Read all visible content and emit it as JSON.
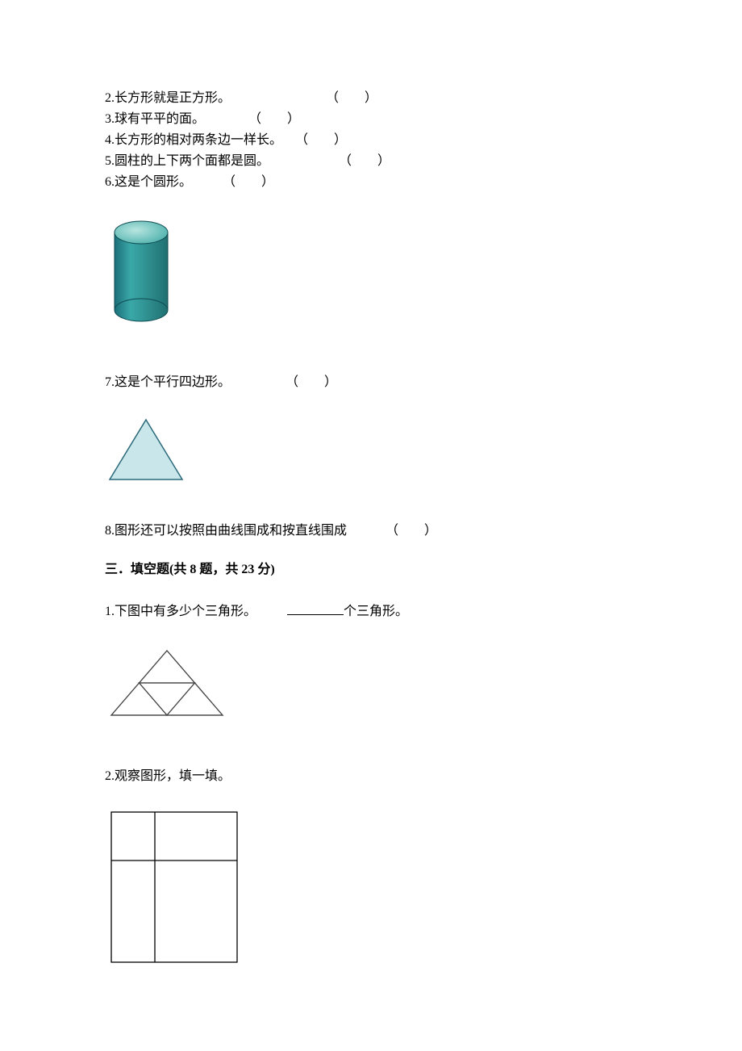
{
  "tf": {
    "q2": "2.长方形就是正方形。",
    "q2_paren": "（　　）",
    "q3": "3.球有平平的面。",
    "q3_paren": "（　　）",
    "q4": "4.长方形的相对两条边一样长。",
    "q4_paren": "（　　）",
    "q5": "5.圆柱的上下两个面都是圆。",
    "q5_paren": "（　　）",
    "q6": "6.这是个圆形。",
    "q6_paren": "（　　）",
    "q7": "7.这是个平行四边形。",
    "q7_paren": "（　　）",
    "q8": "8.图形还可以按照由曲线围成和按直线围成",
    "q8_paren": "（　　）"
  },
  "section3": {
    "heading": "三．填空题(共 8 题，共 23 分)"
  },
  "fill": {
    "q1_pre": "1.下图中有多少个三角形。",
    "q1_post": "个三角形。",
    "q2": "2.观察图形，填一填。"
  }
}
